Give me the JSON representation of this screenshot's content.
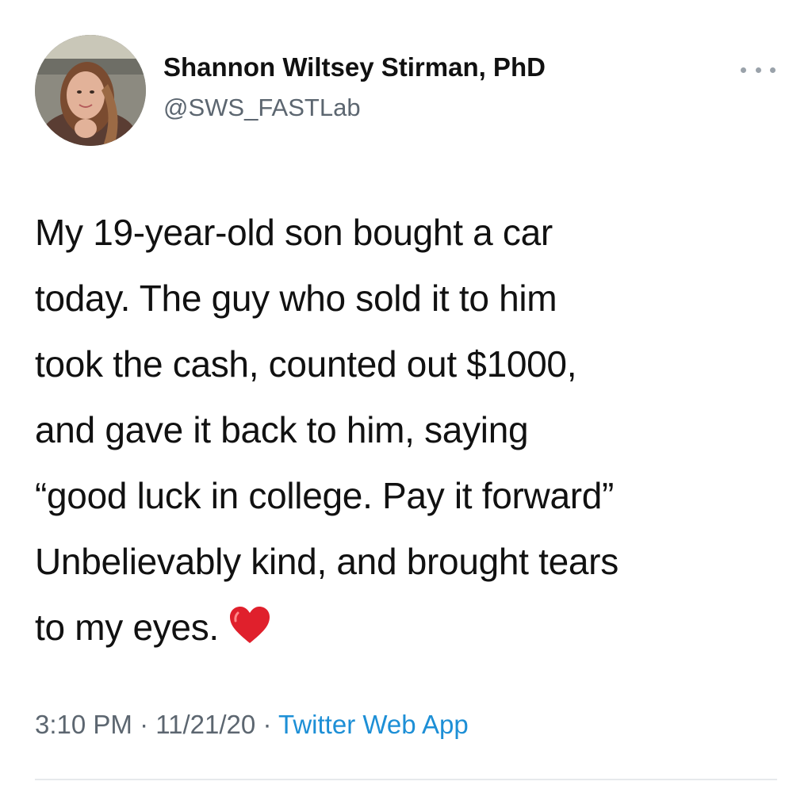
{
  "author": {
    "name": "Shannon Wiltsey Stirman, PhD",
    "handle": "@SWS_FASTLab"
  },
  "tweet": {
    "lines": [
      "My 19-year-old son bought a car",
      "today. The guy who sold it to him",
      "took the cash, counted out $1000,",
      "and gave it back to him, saying",
      "“good luck in college. Pay it forward”",
      "Unbelievably kind, and brought tears",
      "to my eyes."
    ],
    "emoji": "red-heart-icon"
  },
  "meta": {
    "time": "3:10 PM",
    "separator": "·",
    "date": "11/21/20",
    "source": "Twitter Web App"
  },
  "colors": {
    "text": "#111111",
    "secondary": "#5c6670",
    "link": "#1d8fd6",
    "heart": "#e0202c"
  },
  "icons": {
    "more": "more-options-icon",
    "avatar": "profile-photo"
  }
}
